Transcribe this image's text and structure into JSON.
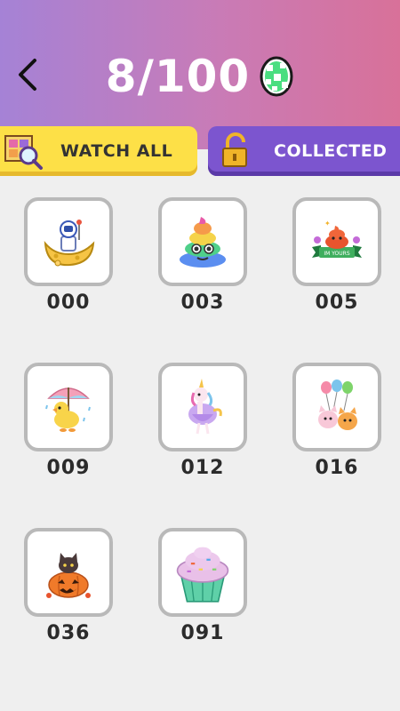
{
  "header": {
    "counter": "8/100",
    "back_icon": "chevron-left-icon",
    "egg_icon": "egg-icon",
    "colors": {
      "gradient_start": "#a582d6",
      "gradient_end": "#d87199"
    }
  },
  "tabs": [
    {
      "label": "WATCH ALL",
      "icon": "search-picture-icon",
      "color": "#fde047"
    },
    {
      "label": "COLLECTED",
      "icon": "unlock-icon",
      "color": "#7c55cf"
    }
  ],
  "items": [
    {
      "number": "000",
      "icon": "astronaut-moon-icon"
    },
    {
      "number": "003",
      "icon": "rainbow-poop-icon"
    },
    {
      "number": "005",
      "icon": "poop-banner-icon"
    },
    {
      "number": "009",
      "icon": "duck-umbrella-icon"
    },
    {
      "number": "012",
      "icon": "unicorn-icon"
    },
    {
      "number": "016",
      "icon": "cats-balloons-icon"
    },
    {
      "number": "036",
      "icon": "cat-pumpkin-icon"
    },
    {
      "number": "091",
      "icon": "cupcake-icon"
    }
  ]
}
